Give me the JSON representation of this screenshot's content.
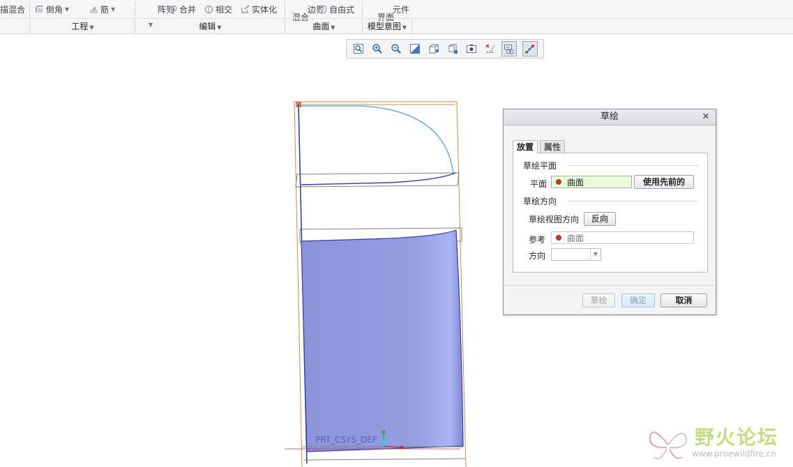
{
  "ribbon": {
    "items": {
      "blend": "描混合",
      "round": "倒角",
      "rib": "筋",
      "pattern": "阵列",
      "merge": "合并",
      "intersect": "相交",
      "solidify": "实体化",
      "boundary_blend": "边界\n混合",
      "freestyle": "自由式",
      "interface": "元件\n界面"
    },
    "groups": {
      "engineering": "工程",
      "editing": "编辑",
      "surfaces": "曲面",
      "model_intent": "模型意图"
    }
  },
  "viewbar": {
    "icons": [
      "refit-icon",
      "zoom-in-icon",
      "zoom-out-icon",
      "repaint-icon",
      "display-style-icon",
      "saved-views-icon",
      "view-manager-icon",
      "datum-display-icon",
      "annotation-display-icon",
      "spin-center-icon",
      "csys-display-icon"
    ]
  },
  "model": {
    "csys_label": "PRT_CSYS_DEF"
  },
  "dialog": {
    "title": "草绘",
    "tabs": {
      "placement": "放置",
      "properties": "属性"
    },
    "sketch_plane_section": "草绘平面",
    "plane_label": "平面",
    "plane_value": "曲面",
    "use_previous_button": "使用先前的",
    "orientation_section": "草绘方向",
    "view_direction_label": "草绘视图方向",
    "flip_button": "反向",
    "reference_label": "参考",
    "reference_value": "曲面",
    "direction_label": "方向",
    "direction_value": "",
    "buttons": {
      "sketch": "草绘",
      "ok": "确定",
      "cancel": "取消"
    },
    "colors": {
      "plane_field_bg": "#e8fbd8",
      "reference_dot": "#c9302c"
    }
  },
  "watermark": {
    "text": "野火论坛",
    "url": "www.proewildfire.cn"
  }
}
